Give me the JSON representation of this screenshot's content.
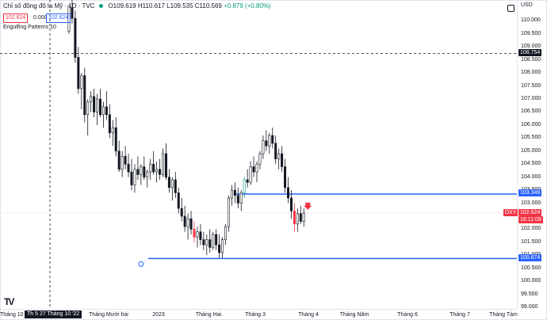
{
  "header": {
    "title": "Chỉ số đồng đô la Mỹ · 1D · TVC",
    "ohlc_open": "O109.619",
    "ohlc_high": "H110.617",
    "ohlc_low": "L109.535",
    "ohlc_close": "C110.569",
    "change": "+0.879 (+0.80%)",
    "sell_price": "102.624",
    "spread": "0.000",
    "buy_price": "102.624",
    "indicator_label": "Engulfing Patterns  10"
  },
  "price_axis": {
    "currency": "USD",
    "ticks": [
      "110.000",
      "109.500",
      "109.000",
      "108.500",
      "108.000",
      "107.500",
      "107.000",
      "106.500",
      "106.000",
      "105.500",
      "105.000",
      "104.500",
      "104.000",
      "103.500",
      "103.000",
      "102.500",
      "102.000",
      "101.500",
      "101.000",
      "100.500",
      "100.000",
      "99.500",
      "99.000"
    ],
    "crosshair_label": "108.754",
    "resistance_label": "103.349",
    "support_label": "100.874",
    "symbol_tag": "DXY",
    "last_price_label": "102.624",
    "countdown_label": "16:11:09"
  },
  "time_axis": {
    "crosshair_date": "Th 5 27 Tháng 10 '22",
    "ticks": [
      "Tháng 10",
      "Tháng Mười hai",
      "2023",
      "Tháng Hai",
      "Tháng 3",
      "Tháng 4",
      "Tháng Năm",
      "Tháng 6",
      "Tháng 7",
      "Tháng Tám"
    ]
  },
  "colors": {
    "up": "#089981",
    "down": "#f23645",
    "level_line": "#2962ff",
    "crosshair": "#131722"
  },
  "chart_data": {
    "type": "candlestick",
    "ylim": [
      99.0,
      110.5
    ],
    "levels": [
      103.349,
      100.874
    ],
    "last_price": 102.624,
    "candles": [
      [
        109.6,
        110.6,
        109.5,
        110.57
      ],
      [
        110.5,
        110.9,
        109.9,
        110.1
      ],
      [
        110.1,
        110.4,
        108.4,
        108.6
      ],
      [
        108.6,
        109.0,
        107.2,
        107.4
      ],
      [
        107.4,
        108.0,
        106.6,
        107.9
      ],
      [
        107.9,
        108.2,
        106.1,
        106.4
      ],
      [
        106.4,
        107.0,
        105.6,
        106.9
      ],
      [
        106.9,
        107.3,
        106.5,
        107.1
      ],
      [
        107.1,
        107.4,
        106.3,
        106.5
      ],
      [
        106.5,
        107.2,
        106.0,
        107.0
      ],
      [
        107.0,
        107.4,
        106.3,
        106.4
      ],
      [
        106.4,
        106.9,
        105.9,
        106.7
      ],
      [
        106.7,
        107.3,
        106.2,
        106.4
      ],
      [
        106.4,
        106.8,
        105.5,
        105.7
      ],
      [
        105.7,
        106.2,
        105.2,
        105.9
      ],
      [
        105.9,
        106.3,
        104.8,
        105.0
      ],
      [
        105.0,
        105.4,
        104.2,
        104.3
      ],
      [
        104.3,
        105.0,
        104.0,
        104.8
      ],
      [
        104.8,
        105.2,
        104.3,
        104.5
      ],
      [
        104.5,
        104.9,
        104.0,
        104.2
      ],
      [
        104.2,
        104.7,
        103.5,
        103.7
      ],
      [
        103.7,
        104.5,
        103.4,
        104.3
      ],
      [
        104.3,
        104.8,
        103.9,
        104.1
      ],
      [
        104.1,
        104.5,
        103.7,
        104.4
      ],
      [
        104.4,
        104.8,
        103.9,
        104.0
      ],
      [
        104.0,
        104.3,
        103.6,
        104.2
      ],
      [
        104.2,
        104.7,
        103.9,
        104.5
      ],
      [
        104.5,
        105.0,
        104.1,
        104.2
      ],
      [
        104.2,
        104.6,
        103.8,
        104.3
      ],
      [
        104.3,
        104.7,
        103.9,
        104.1
      ],
      [
        104.1,
        105.1,
        104.0,
        104.9
      ],
      [
        104.9,
        105.3,
        103.9,
        104.0
      ],
      [
        104.0,
        104.3,
        103.4,
        103.6
      ],
      [
        103.6,
        104.0,
        103.1,
        103.9
      ],
      [
        103.9,
        104.2,
        103.2,
        103.4
      ],
      [
        103.4,
        103.6,
        102.6,
        102.8
      ],
      [
        102.8,
        103.2,
        102.3,
        102.5
      ],
      [
        102.5,
        102.9,
        101.9,
        102.1
      ],
      [
        102.1,
        102.6,
        101.6,
        102.4
      ],
      [
        102.4,
        102.7,
        101.8,
        102.0
      ],
      [
        102.0,
        102.3,
        101.5,
        101.7
      ],
      [
        101.7,
        102.1,
        101.3,
        101.9
      ],
      [
        101.9,
        102.2,
        101.4,
        101.6
      ],
      [
        101.6,
        101.9,
        101.2,
        101.4
      ],
      [
        101.4,
        101.8,
        101.0,
        101.6
      ],
      [
        101.6,
        102.0,
        101.1,
        101.3
      ],
      [
        101.3,
        101.9,
        101.2,
        101.8
      ],
      [
        101.8,
        102.0,
        101.2,
        101.4
      ],
      [
        101.4,
        101.8,
        100.9,
        101.1
      ],
      [
        101.1,
        101.7,
        100.9,
        101.6
      ],
      [
        101.6,
        102.2,
        101.4,
        102.1
      ],
      [
        102.1,
        103.3,
        101.9,
        103.2
      ],
      [
        103.2,
        103.7,
        102.9,
        103.5
      ],
      [
        103.5,
        103.8,
        103.0,
        103.3
      ],
      [
        103.3,
        103.6,
        102.8,
        103.0
      ],
      [
        103.0,
        103.5,
        102.7,
        103.4
      ],
      [
        103.4,
        104.0,
        103.2,
        103.9
      ],
      [
        103.9,
        104.3,
        103.6,
        103.8
      ],
      [
        103.8,
        104.6,
        103.7,
        104.4
      ],
      [
        104.4,
        104.8,
        104.0,
        104.2
      ],
      [
        104.2,
        104.6,
        103.8,
        104.5
      ],
      [
        104.5,
        105.0,
        104.3,
        104.9
      ],
      [
        104.9,
        105.6,
        104.7,
        105.4
      ],
      [
        105.4,
        105.8,
        105.0,
        105.2
      ],
      [
        105.2,
        105.7,
        104.9,
        105.6
      ],
      [
        105.6,
        105.9,
        105.1,
        105.3
      ],
      [
        105.3,
        105.6,
        104.5,
        104.7
      ],
      [
        104.7,
        105.1,
        104.3,
        104.9
      ],
      [
        104.9,
        105.2,
        104.2,
        104.4
      ],
      [
        104.4,
        104.7,
        103.4,
        103.6
      ],
      [
        103.6,
        104.0,
        103.0,
        103.2
      ],
      [
        103.2,
        103.5,
        102.4,
        102.7
      ],
      [
        102.7,
        103.0,
        101.9,
        102.2
      ],
      [
        102.2,
        102.8,
        101.9,
        102.6
      ],
      [
        102.6,
        102.9,
        102.2,
        102.3
      ],
      [
        102.3,
        102.8,
        102.1,
        102.62
      ]
    ]
  }
}
